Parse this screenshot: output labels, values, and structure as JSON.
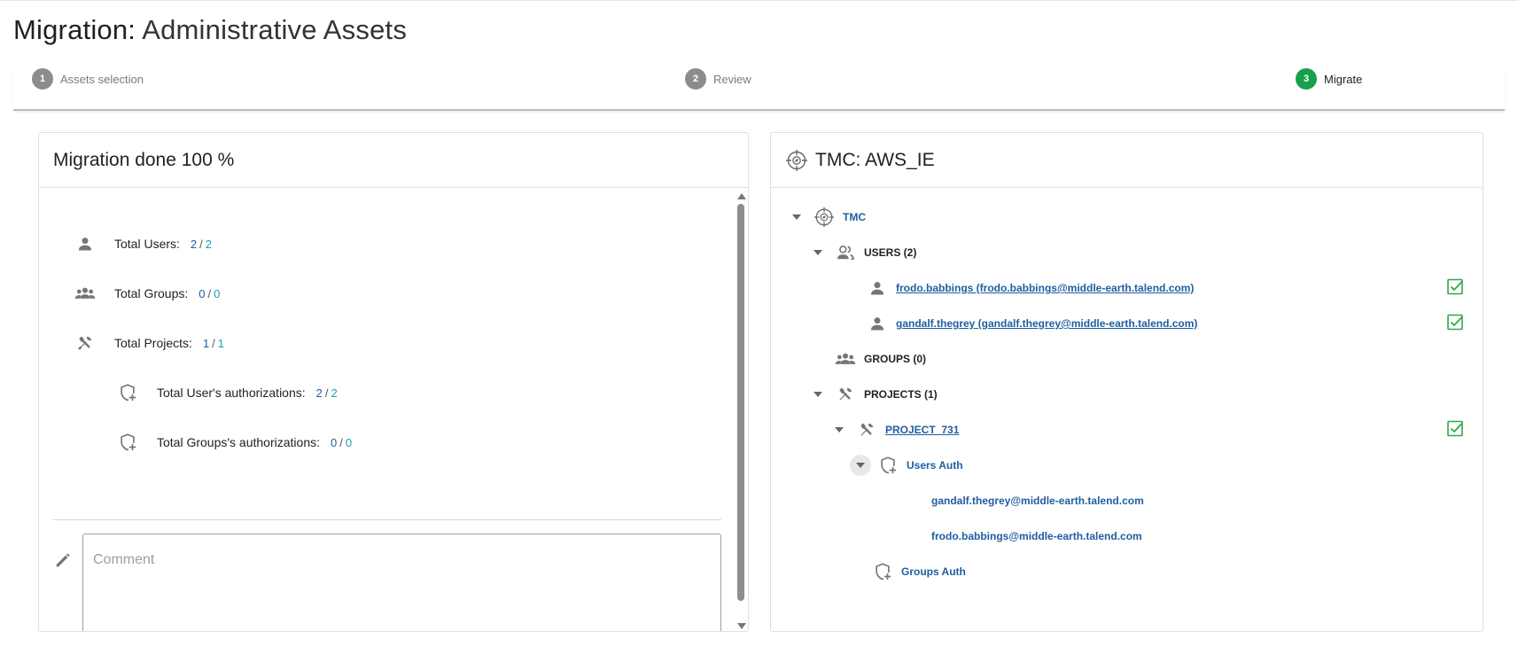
{
  "page": {
    "title_prefix": "Migration:",
    "title_name": "Administrative Assets"
  },
  "stepper": {
    "steps": [
      {
        "number": "1",
        "label": "Assets selection",
        "state": "completed"
      },
      {
        "number": "2",
        "label": "Review",
        "state": "completed"
      },
      {
        "number": "3",
        "label": "Migrate",
        "state": "active"
      }
    ],
    "colors": {
      "inactive": "#8c8c8c",
      "active": "#17a14c"
    }
  },
  "summary": {
    "title": "Migration done 100 %",
    "rows": [
      {
        "label": "Total Users:",
        "done": "2",
        "sep": "/",
        "total": "2",
        "icon": "user-icon"
      },
      {
        "label": "Total Groups:",
        "done": "0",
        "sep": "/",
        "total": "0",
        "icon": "group-icon"
      },
      {
        "label": "Total Projects:",
        "done": "1",
        "sep": "/",
        "total": "1",
        "icon": "tools-icon"
      },
      {
        "label": "Total User's authorizations:",
        "done": "2",
        "sep": "/",
        "total": "2",
        "icon": "shield-plus-icon"
      },
      {
        "label": "Total Groups's authorizations:",
        "done": "0",
        "sep": "/",
        "total": "0",
        "icon": "shield-plus-icon"
      }
    ],
    "comment": {
      "placeholder": "Comment",
      "value": ""
    }
  },
  "target": {
    "title": "TMC: AWS_IE",
    "tree": {
      "root": "TMC",
      "users_label": "USERS (2)",
      "users": [
        "frodo.babbings (frodo.babbings@middle-earth.talend.com)",
        "gandalf.thegrey (gandalf.thegrey@middle-earth.talend.com)"
      ],
      "groups_label": "GROUPS (0)",
      "projects_label": "PROJECTS (1)",
      "project": "PROJECT_731",
      "users_auth_label": "Users Auth",
      "users_auth": [
        "gandalf.thegrey@middle-earth.talend.com",
        "frodo.babbings@middle-earth.talend.com"
      ],
      "groups_auth_label": "Groups Auth"
    },
    "colors": {
      "link": "#1f5ea0",
      "check": "#2ea84a"
    }
  }
}
